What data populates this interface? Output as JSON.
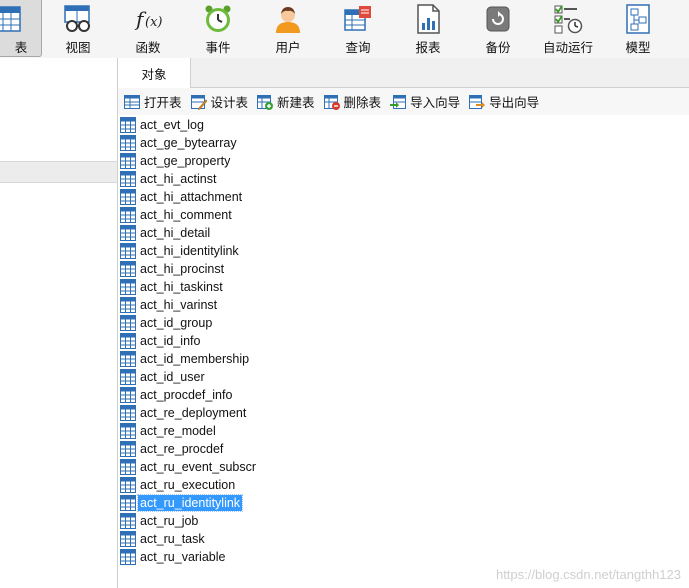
{
  "toolbar": {
    "items": [
      {
        "label": "表",
        "icon": "table-icon",
        "active": true
      },
      {
        "label": "视图",
        "icon": "view-icon"
      },
      {
        "label": "函数",
        "icon": "function-icon"
      },
      {
        "label": "事件",
        "icon": "event-clock-icon"
      },
      {
        "label": "用户",
        "icon": "user-icon"
      },
      {
        "label": "查询",
        "icon": "query-icon"
      },
      {
        "label": "报表",
        "icon": "report-icon"
      },
      {
        "label": "备份",
        "icon": "backup-icon"
      },
      {
        "label": "自动运行",
        "icon": "auto-run-icon"
      },
      {
        "label": "模型",
        "icon": "model-icon"
      }
    ]
  },
  "tabs": {
    "objects_label": "对象"
  },
  "object_toolbar": {
    "open_table": "打开表",
    "design_table": "设计表",
    "new_table": "新建表",
    "delete_table": "删除表",
    "import_wizard": "导入向导",
    "export_wizard": "导出向导"
  },
  "tables": [
    "act_evt_log",
    "act_ge_bytearray",
    "act_ge_property",
    "act_hi_actinst",
    "act_hi_attachment",
    "act_hi_comment",
    "act_hi_detail",
    "act_hi_identitylink",
    "act_hi_procinst",
    "act_hi_taskinst",
    "act_hi_varinst",
    "act_id_group",
    "act_id_info",
    "act_id_membership",
    "act_id_user",
    "act_procdef_info",
    "act_re_deployment",
    "act_re_model",
    "act_re_procdef",
    "act_ru_event_subscr",
    "act_ru_execution",
    "act_ru_identitylink",
    "act_ru_job",
    "act_ru_task",
    "act_ru_variable"
  ],
  "selected_table": "act_ru_identitylink",
  "watermark": "https://blog.csdn.net/tangthh123",
  "colors": {
    "selection": "#3399ff",
    "toolbar_bg": "#f5f5f5"
  }
}
